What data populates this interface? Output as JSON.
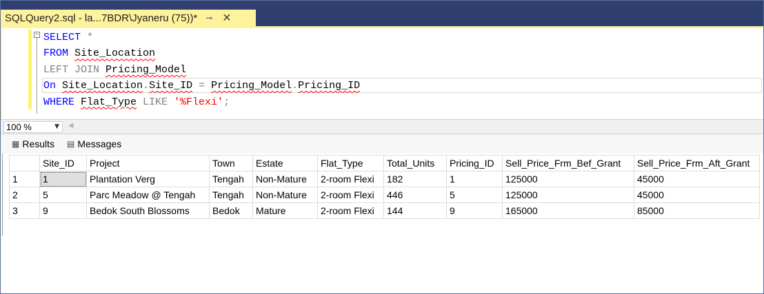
{
  "tab": {
    "title": "SQLQuery2.sql - la...7BDR\\Jyaneru (75))*",
    "pin_icon": "pin-icon",
    "close_icon": "close-icon"
  },
  "editor": {
    "lines": [
      {
        "parts": [
          {
            "t": "SELECT ",
            "c": "kw"
          },
          {
            "t": "*",
            "c": "gray"
          }
        ]
      },
      {
        "parts": [
          {
            "t": "FROM ",
            "c": "kw"
          },
          {
            "t": "Site_Location",
            "c": "id squig"
          }
        ]
      },
      {
        "parts": [
          {
            "t": "LEFT JOIN ",
            "c": "gray"
          },
          {
            "t": "Pricing_Model",
            "c": "id squig"
          }
        ]
      },
      {
        "parts": [
          {
            "t": "On ",
            "c": "kw"
          },
          {
            "t": "Site_Location",
            "c": "id squig"
          },
          {
            "t": ".",
            "c": "gray"
          },
          {
            "t": "Site_ID",
            "c": "id squig"
          },
          {
            "t": " = ",
            "c": "gray"
          },
          {
            "t": "Pricing_Model",
            "c": "id squig"
          },
          {
            "t": ".",
            "c": "gray"
          },
          {
            "t": "Pricing_ID",
            "c": "id squig"
          }
        ]
      },
      {
        "parts": [
          {
            "t": "WHERE ",
            "c": "kw"
          },
          {
            "t": "Flat_Type",
            "c": "id squig"
          },
          {
            "t": " LIKE ",
            "c": "gray"
          },
          {
            "t": "'%Flexi'",
            "c": "str"
          },
          {
            "t": ";",
            "c": "gray"
          }
        ]
      }
    ]
  },
  "zoom": {
    "value": "100 %"
  },
  "results_tabs": {
    "results": "Results",
    "messages": "Messages"
  },
  "grid": {
    "columns": [
      "",
      "Site_ID",
      "Project",
      "Town",
      "Estate",
      "Flat_Type",
      "Total_Units",
      "Pricing_ID",
      "Sell_Price_Frm_Bef_Grant",
      "Sell_Price_Frm_Aft_Grant"
    ],
    "rows": [
      [
        "1",
        "1",
        "Plantation Verg",
        "Tengah",
        "Non-Mature",
        "2-room Flexi",
        "182",
        "1",
        "125000",
        "45000"
      ],
      [
        "2",
        "5",
        "Parc Meadow @ Tengah",
        "Tengah",
        "Non-Mature",
        "2-room Flexi",
        "446",
        "5",
        "125000",
        "45000"
      ],
      [
        "3",
        "9",
        "Bedok South Blossoms",
        "Bedok",
        "Mature",
        "2-room Flexi",
        "144",
        "9",
        "165000",
        "85000"
      ]
    ]
  },
  "colors": {
    "tab_active": "#fff29d",
    "tabstrip_bg": "#2f3f6f",
    "keyword": "#0000ff",
    "string": "#ff0000",
    "operator": "#808080"
  }
}
